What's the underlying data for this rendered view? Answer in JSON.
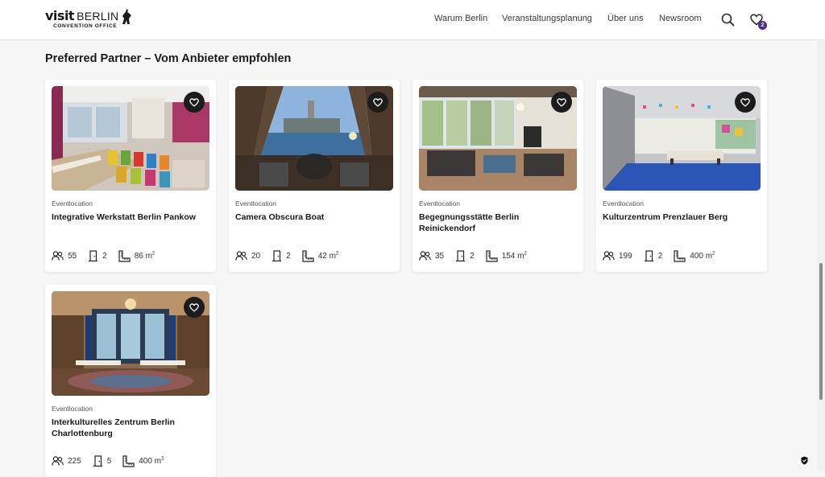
{
  "header": {
    "logo": {
      "visit": "visit",
      "berlin": "BERLIN",
      "subtitle": "CONVENTION OFFICE"
    },
    "nav": [
      "Warum Berlin",
      "Veranstaltungsplanung",
      "Über uns",
      "Newsroom"
    ],
    "cart_count": "2",
    "icons": {
      "search": "search-icon",
      "favorites": "heart-cart-icon"
    }
  },
  "section": {
    "title": "Preferred Partner – Vom Anbieter empfohlen"
  },
  "cards": [
    {
      "category": "Eventlocation",
      "title": "Integrative Werkstatt Berlin Pankow",
      "persons": "55",
      "rooms": "2",
      "area": "86 m",
      "area_unit": "2"
    },
    {
      "category": "Eventlocation",
      "title": "Camera Obscura Boat",
      "persons": "20",
      "rooms": "2",
      "area": "42 m",
      "area_unit": "2"
    },
    {
      "category": "Eventlocation",
      "title": "Begegnungsstätte Berlin Reinickendorf",
      "persons": "35",
      "rooms": "2",
      "area": "154 m",
      "area_unit": "2"
    },
    {
      "category": "Eventlocation",
      "title": "Kulturzentrum Prenzlauer Berg",
      "persons": "199",
      "rooms": "2",
      "area": "400 m",
      "area_unit": "2"
    },
    {
      "category": "Eventlocation",
      "title": "Interkulturelles Zentrum Berlin Charlottenburg",
      "persons": "225",
      "rooms": "5",
      "area": "400 m",
      "area_unit": "2"
    }
  ],
  "colors": {
    "accent": "#4d2f8f",
    "fav_button": "#1c1c1c",
    "page_bg": "#f7f7f7"
  }
}
